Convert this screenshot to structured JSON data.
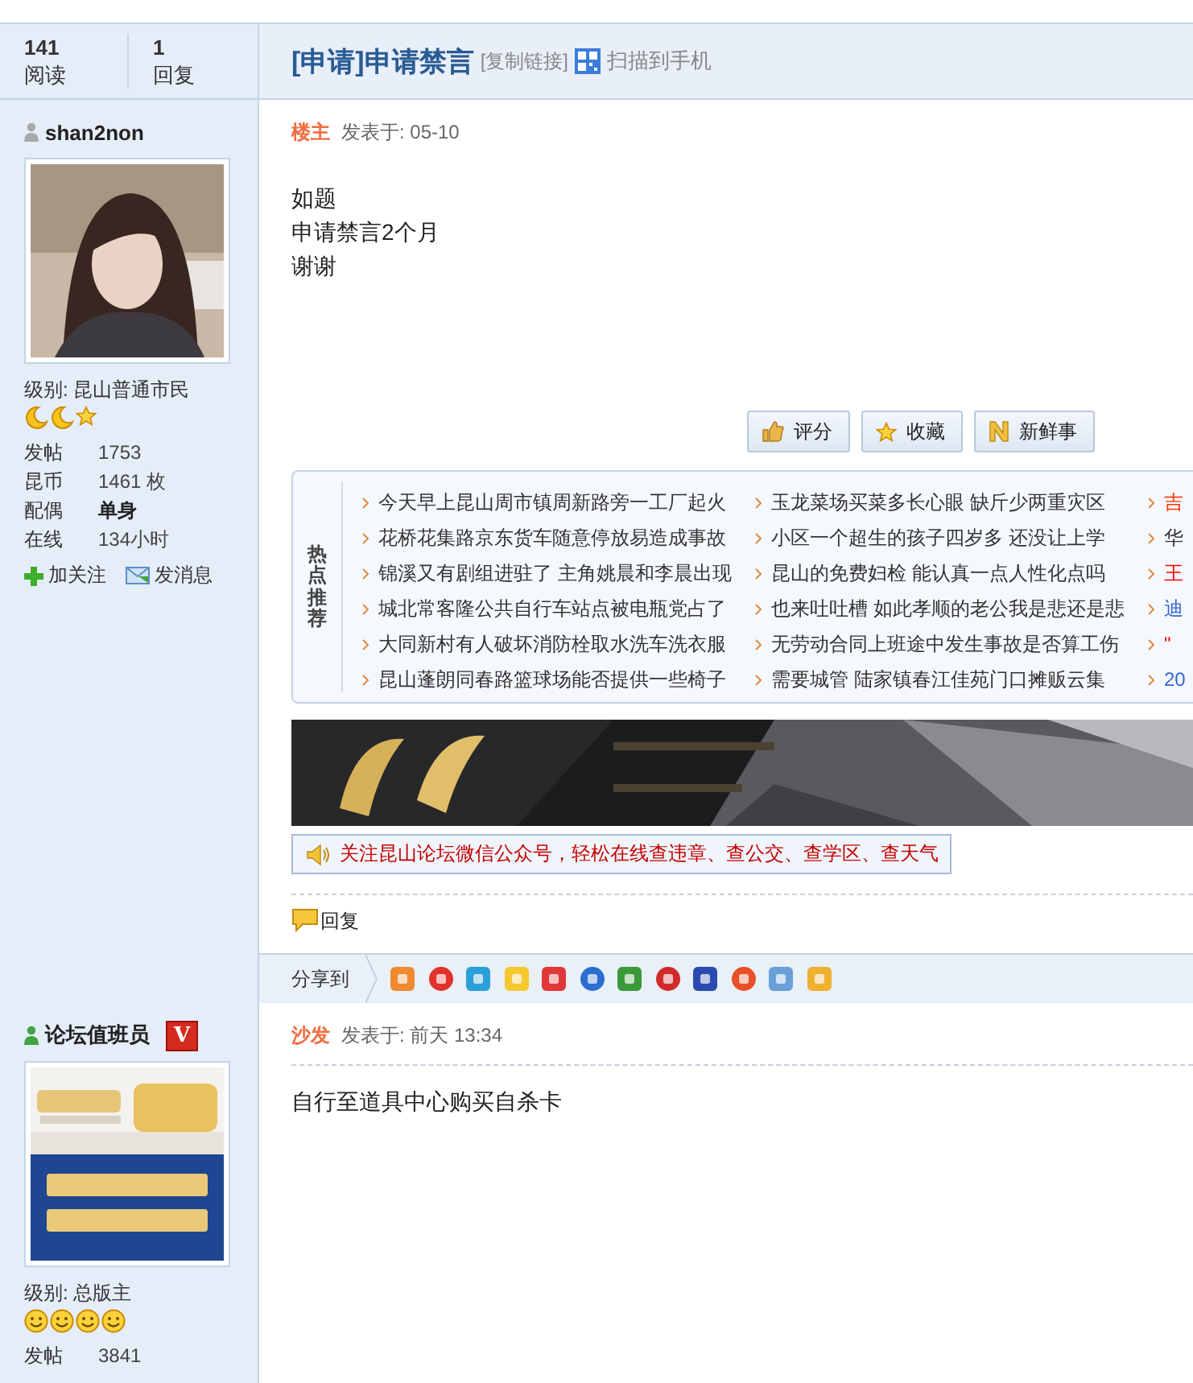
{
  "thread": {
    "views": "141",
    "views_label": "阅读",
    "replies": "1",
    "replies_label": "回复",
    "title": "[申请]申请禁言",
    "copy_link": "[复制链接]",
    "scan_link": "扫描到手机"
  },
  "posts": [
    {
      "author": "shan2non",
      "online": false,
      "avatar": {
        "kind": "picture"
      },
      "level": "级别: 昆山普通市民",
      "ranks": [
        {
          "kind": "moon"
        },
        {
          "kind": "moon"
        },
        {
          "kind": "star"
        }
      ],
      "stats": [
        {
          "label": "发帖",
          "value": "1753",
          "bold": false
        },
        {
          "label": "昆币",
          "value": "1461 枚",
          "bold": false
        },
        {
          "label": "配偶",
          "value": "单身",
          "bold": true
        },
        {
          "label": "在线",
          "value": "134小时",
          "bold": false
        }
      ],
      "actions": [
        {
          "kind": "follow",
          "label": "加关注"
        },
        {
          "kind": "message",
          "label": "发消息"
        }
      ],
      "floor": "楼主",
      "posted": "发表于: 05-10",
      "body": [
        "如题",
        "申请禁言2个月",
        "谢谢"
      ],
      "buttons": [
        {
          "kind": "rate",
          "label": "评分"
        },
        {
          "kind": "favorite",
          "label": "收藏"
        },
        {
          "kind": "news",
          "label": "新鲜事"
        }
      ],
      "hot": {
        "title": "热点推荐",
        "columns": [
          [
            {
              "text": "今天早上昆山周市镇周新路旁一工厂起火",
              "color": "#333333"
            },
            {
              "text": "花桥花集路京东货车随意停放易造成事故",
              "color": "#333333"
            },
            {
              "text": "锦溪又有剧组进驻了 主角姚晨和李晨出现",
              "color": "#333333"
            },
            {
              "text": "城北常客隆公共自行车站点被电瓶党占了",
              "color": "#333333"
            },
            {
              "text": "大同新村有人破坏消防栓取水洗车洗衣服",
              "color": "#333333"
            },
            {
              "text": "昆山蓬朗同春路篮球场能否提供一些椅子",
              "color": "#333333"
            }
          ],
          [
            {
              "text": "玉龙菜场买菜多长心眼 缺斤少两重灾区",
              "color": "#333333"
            },
            {
              "text": "小区一个超生的孩子四岁多 还没让上学",
              "color": "#333333"
            },
            {
              "text": "昆山的免费妇检 能认真一点人性化点吗",
              "color": "#333333"
            },
            {
              "text": "也来吐吐槽 如此孝顺的老公我是悲还是悲",
              "color": "#333333"
            },
            {
              "text": "无劳动合同上班途中发生事故是否算工伤",
              "color": "#333333"
            },
            {
              "text": "需要城管 陆家镇春江佳苑门口摊贩云集",
              "color": "#333333"
            }
          ],
          [
            {
              "text": "吉",
              "color": "#ff3300"
            },
            {
              "text": "华",
              "color": "#333333"
            },
            {
              "text": "王",
              "color": "#ff0000"
            },
            {
              "text": "迪",
              "color": "#3366cc"
            },
            {
              "text": "\"",
              "color": "#ff0000"
            },
            {
              "text": "20",
              "color": "#3366cc"
            }
          ]
        ]
      },
      "banner": {
        "kind": "picture"
      },
      "notice": "关注昆山论坛微信公众号，轻松在线查违章、查公交、查学区、查天气",
      "reply": "回复"
    },
    {
      "author": "论坛值班员",
      "online": true,
      "badge": "V",
      "avatar": {
        "kind": "picture"
      },
      "level": "级别: 总版主",
      "ranks": [
        {
          "kind": "smiley"
        },
        {
          "kind": "smiley"
        },
        {
          "kind": "smiley"
        },
        {
          "kind": "smiley"
        }
      ],
      "stats": [
        {
          "label": "发帖",
          "value": "3841",
          "bold": false
        }
      ],
      "floor": "沙发",
      "posted": "发表于: 前天 13:34",
      "body": [
        "自行至道具中心购买自杀卡"
      ]
    }
  ],
  "share_bar": {
    "label": "分享到"
  }
}
